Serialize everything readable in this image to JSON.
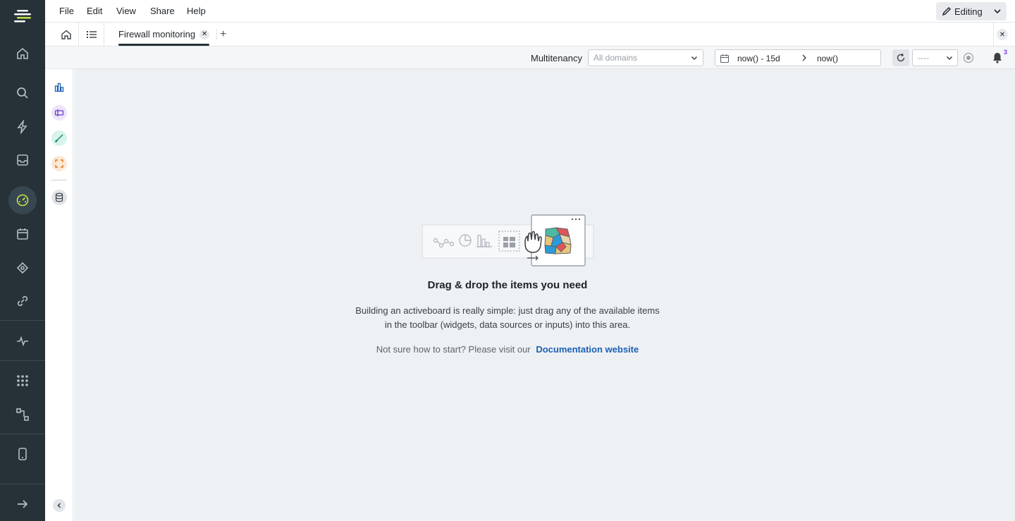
{
  "menu": {
    "items": [
      "File",
      "Edit",
      "View",
      "Share",
      "Help"
    ],
    "editing_label": "Editing"
  },
  "tabs": {
    "active_label": "Firewall monitoring",
    "add_label": "+"
  },
  "toolbar": {
    "multitenancy_label": "Multitenancy",
    "domain_placeholder": "All domains",
    "date_from": "now() - 15d",
    "date_to": "now()",
    "interval_placeholder": "----",
    "notification_count": "3"
  },
  "empty_state": {
    "title": "Drag & drop the items you need",
    "description": "Building an activeboard is really simple: just drag any of the available items in the toolbar (widgets, data sources or inputs) into this area.",
    "help_text": "Not sure how to start? Please visit our",
    "link_label": "Documentation website"
  },
  "colors": {
    "nav_bg": "#263238",
    "canvas_bg": "#eef1f4",
    "link": "#1a5fb4",
    "badge": "#7b3fe4"
  },
  "icons": {
    "leftnav": [
      "logo-icon",
      "home-icon",
      "search-icon",
      "bolt-icon",
      "inbox-icon",
      "dashboard-icon",
      "calendar-icon",
      "network-icon",
      "link-icon",
      "pulse-icon",
      "apps-grid-icon",
      "flow-icon",
      "mobile-icon",
      "expand-icon"
    ],
    "widgetbar": [
      "chart-widget-icon",
      "input-widget-icon",
      "brush-widget-icon",
      "frame-widget-icon",
      "database-icon",
      "collapse-icon"
    ]
  }
}
